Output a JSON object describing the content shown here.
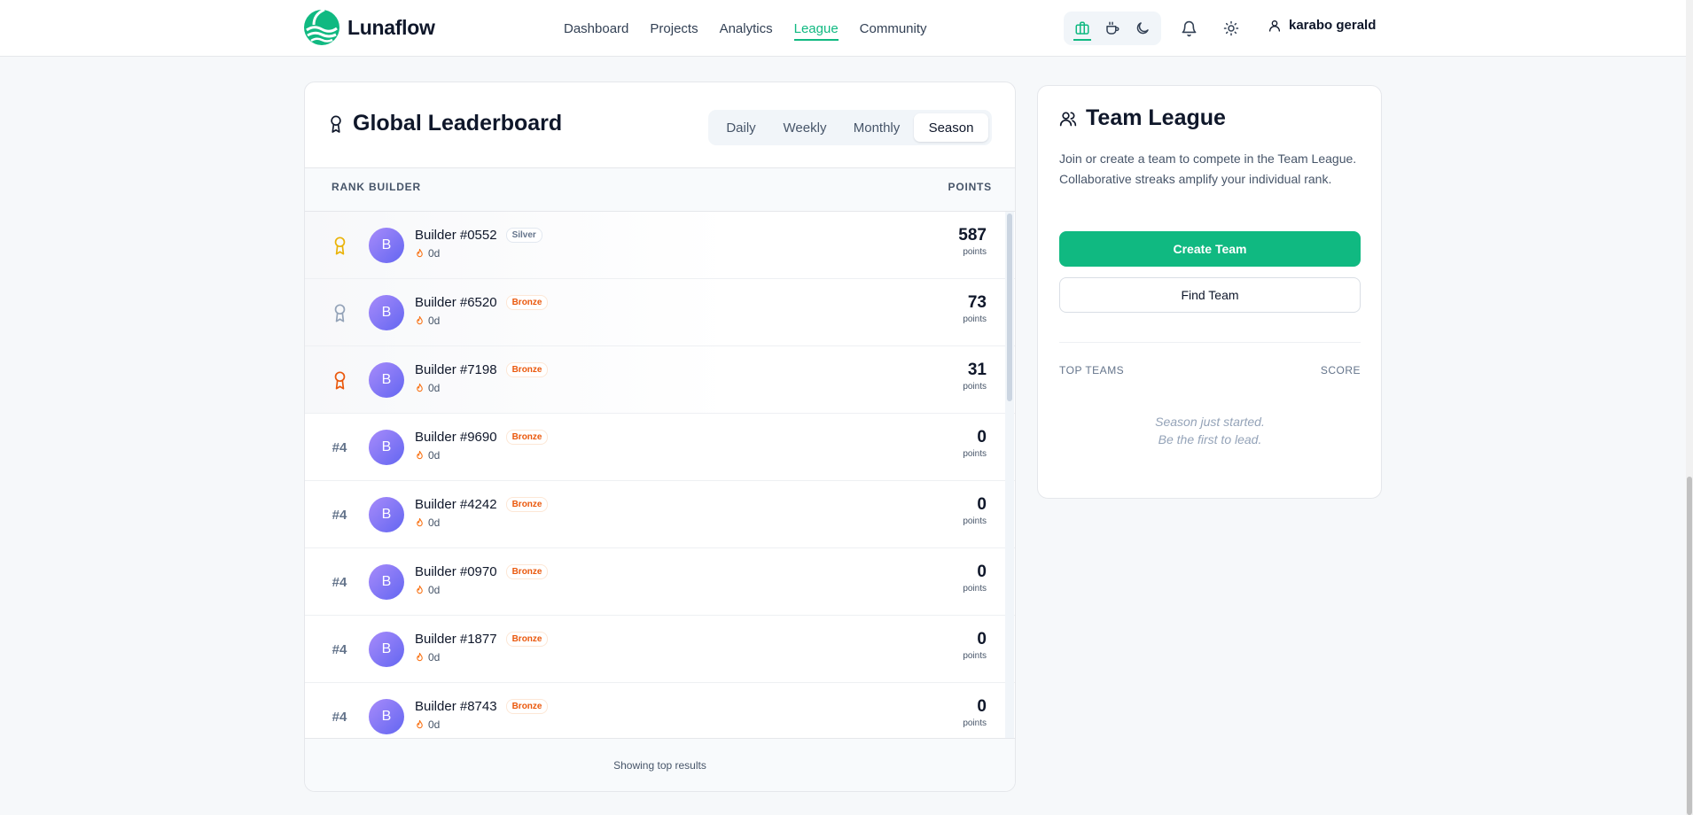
{
  "brand": {
    "name": "Lunaflow",
    "accent": "#10b981"
  },
  "nav": [
    {
      "label": "Dashboard",
      "active": false
    },
    {
      "label": "Projects",
      "active": false
    },
    {
      "label": "Analytics",
      "active": false
    },
    {
      "label": "League",
      "active": true
    },
    {
      "label": "Community",
      "active": false
    }
  ],
  "modes": [
    "briefcase-icon",
    "coffee-icon",
    "moon-icon"
  ],
  "header_icons": [
    "bell-icon",
    "sun-icon"
  ],
  "user": {
    "name": "karabo gerald",
    "icon": "user-icon"
  },
  "leaderboard": {
    "title": "Global Leaderboard",
    "periods": [
      {
        "label": "Daily",
        "active": false
      },
      {
        "label": "Weekly",
        "active": false
      },
      {
        "label": "Monthly",
        "active": false
      },
      {
        "label": "Season",
        "active": true
      }
    ],
    "columns": {
      "rank": "RANK",
      "builder": "BUILDER",
      "points": "POINTS"
    },
    "rows": [
      {
        "rank": "",
        "medal": "gold-medal-icon",
        "avatar": "B",
        "name": "Builder #0552",
        "tier": "Silver",
        "streak": "0d",
        "points": "587",
        "points_label": "points"
      },
      {
        "rank": "",
        "medal": "silver-medal-icon",
        "avatar": "B",
        "name": "Builder #6520",
        "tier": "Bronze",
        "streak": "0d",
        "points": "73",
        "points_label": "points"
      },
      {
        "rank": "",
        "medal": "bronze-medal-icon",
        "avatar": "B",
        "name": "Builder #7198",
        "tier": "Bronze",
        "streak": "0d",
        "points": "31",
        "points_label": "points"
      },
      {
        "rank": "#4",
        "medal": "",
        "avatar": "B",
        "name": "Builder #9690",
        "tier": "Bronze",
        "streak": "0d",
        "points": "0",
        "points_label": "points"
      },
      {
        "rank": "#4",
        "medal": "",
        "avatar": "B",
        "name": "Builder #4242",
        "tier": "Bronze",
        "streak": "0d",
        "points": "0",
        "points_label": "points"
      },
      {
        "rank": "#4",
        "medal": "",
        "avatar": "B",
        "name": "Builder #0970",
        "tier": "Bronze",
        "streak": "0d",
        "points": "0",
        "points_label": "points"
      },
      {
        "rank": "#4",
        "medal": "",
        "avatar": "B",
        "name": "Builder #1877",
        "tier": "Bronze",
        "streak": "0d",
        "points": "0",
        "points_label": "points"
      },
      {
        "rank": "#4",
        "medal": "",
        "avatar": "B",
        "name": "Builder #8743",
        "tier": "Bronze",
        "streak": "0d",
        "points": "0",
        "points_label": "points"
      }
    ],
    "footer": "Showing top results"
  },
  "team": {
    "title": "Team League",
    "description": "Join or create a team to compete in the Team League. Collaborative streaks amplify your individual rank.",
    "create_label": "Create Team",
    "find_label": "Find Team",
    "top_teams_label": "TOP TEAMS",
    "score_label": "SCORE",
    "empty_line1": "Season just started.",
    "empty_line2": "Be the first to lead."
  },
  "colors": {
    "gold": "#eab308",
    "silver": "#94a3b8",
    "bronze": "#ea580c",
    "streak": "#f97316"
  }
}
